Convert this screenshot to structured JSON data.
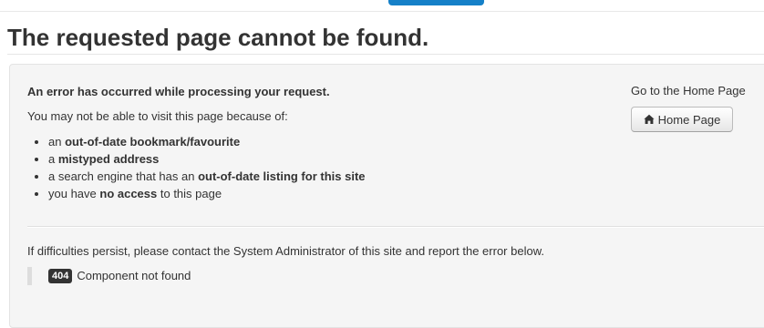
{
  "page": {
    "title": "The requested page cannot be found."
  },
  "error": {
    "heading": "An error has occurred while processing your request.",
    "reasons_intro": "You may not be able to visit this page because of:",
    "reasons": [
      {
        "pre": "an ",
        "bold": "out-of-date bookmark/favourite",
        "post": ""
      },
      {
        "pre": "a ",
        "bold": "mistyped address",
        "post": ""
      },
      {
        "pre": "a search engine that has an ",
        "bold": "out-of-date listing for this site",
        "post": ""
      },
      {
        "pre": "you have ",
        "bold": "no access",
        "post": " to this page"
      }
    ],
    "contact_text": "If difficulties persist, please contact the System Administrator of this site and report the error below.",
    "code": "404",
    "message": "Component not found"
  },
  "home": {
    "label": "Go to the Home Page",
    "button_label": "Home Page",
    "icon": "home-icon"
  },
  "colors": {
    "accent_tab": "#1580c8",
    "well_background": "#f5f5f5",
    "badge_background": "#333333"
  }
}
